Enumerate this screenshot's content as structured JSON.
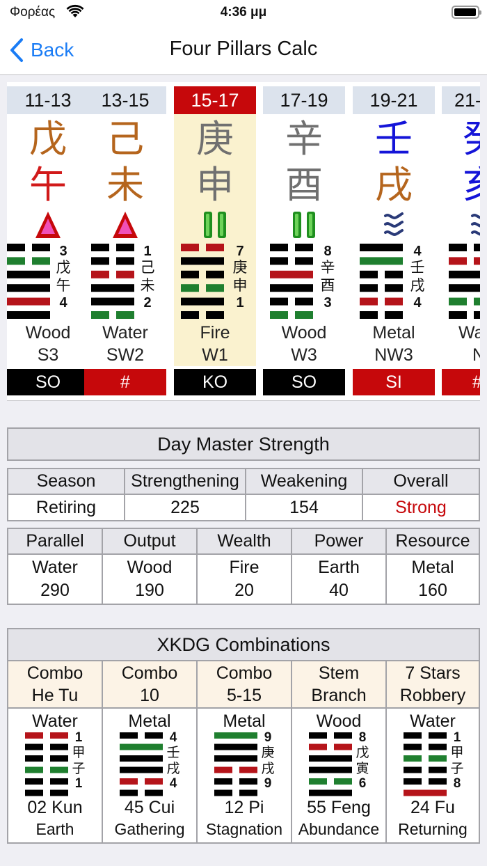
{
  "status": {
    "carrier": "Φορέας",
    "time": "4:36 μμ"
  },
  "nav": {
    "back": "Back",
    "title": "Four Pillars Calc"
  },
  "colors": {
    "accent": "#1a7cf5",
    "red": "#c6080b",
    "green": "#1f7f2f",
    "earth": "#b5651d",
    "metal": "#707070",
    "water": "#1414d8"
  },
  "pillars": [
    {
      "hour": "11-13",
      "stem": "戊",
      "stem_color": "#b5651d",
      "branch": "午",
      "branch_color": "#d11a1a",
      "symbol": "fire-triangle-icon",
      "hex_top": "3",
      "hex_chars": [
        "戊",
        "午"
      ],
      "hex_bottom": "4",
      "lines": [
        "yy",
        "gyy",
        "bb",
        "bb",
        "ry",
        "bb"
      ],
      "element": "Wood",
      "position": "S3",
      "tag": "SO",
      "tag_color": "black"
    },
    {
      "hour": "13-15",
      "stem": "己",
      "stem_color": "#b5651d",
      "branch": "未",
      "branch_color": "#b5651d",
      "symbol": "fire-triangle-icon",
      "hex_top": "1",
      "hex_chars": [
        "己",
        "未"
      ],
      "hex_bottom": "2",
      "lines": [
        "yy",
        "yy",
        "ryy",
        "bb",
        "bb",
        "gyy"
      ],
      "element": "Water",
      "position": "SW2",
      "tag": "#",
      "tag_color": "red"
    },
    {
      "hour": "15-17",
      "stem": "庚",
      "stem_color": "#707070",
      "branch": "申",
      "branch_color": "#707070",
      "symbol": "metal-bars-icon",
      "hex_top": "7",
      "hex_chars": [
        "庚",
        "申"
      ],
      "hex_bottom": "1",
      "lines": [
        "ryy",
        "bb",
        "yy",
        "gyy",
        "bb",
        "yy"
      ],
      "element": "Fire",
      "position": "W1",
      "tag": "KO",
      "tag_color": "black"
    },
    {
      "hour": "17-19",
      "stem": "辛",
      "stem_color": "#707070",
      "branch": "酉",
      "branch_color": "#707070",
      "symbol": "metal-bars-icon",
      "hex_top": "8",
      "hex_chars": [
        "辛",
        "酉"
      ],
      "hex_bottom": "3",
      "lines": [
        "yy",
        "yy",
        "rb",
        "bb",
        "yy",
        "gyy"
      ],
      "element": "Wood",
      "position": "W3",
      "tag": "SO",
      "tag_color": "black"
    },
    {
      "hour": "19-21",
      "stem": "壬",
      "stem_color": "#1414d8",
      "branch": "戌",
      "branch_color": "#b5651d",
      "symbol": "water-waves-icon",
      "hex_top": "4",
      "hex_chars": [
        "壬",
        "戌"
      ],
      "hex_bottom": "4",
      "lines": [
        "bb",
        "gb",
        "yy",
        "yy",
        "ryy",
        "yy"
      ],
      "element": "Metal",
      "position": "NW3",
      "tag": "SI",
      "tag_color": "red"
    },
    {
      "hour": "21-",
      "stem": "癸",
      "stem_color": "#1414d8",
      "branch": "亥",
      "branch_color": "#1414d8",
      "symbol": "water-waves-icon",
      "hex_top": "",
      "hex_chars": [
        "",
        ""
      ],
      "hex_bottom": "",
      "lines": [
        "yy",
        "ryy",
        "bb",
        "bb",
        "gyy",
        "yy"
      ],
      "element": "Wa",
      "position": "N",
      "tag": "#",
      "tag_color": "red"
    }
  ],
  "strength": {
    "title": "Day Master Strength",
    "headers": [
      "Season",
      "Strengthening",
      "Weakening",
      "Overall"
    ],
    "values": [
      "Retiring",
      "225",
      "154",
      "Strong"
    ],
    "overall_color": "#c6080b",
    "elements": [
      {
        "label": "Parallel",
        "element": "Water",
        "value": "290"
      },
      {
        "label": "Output",
        "element": "Wood",
        "value": "190"
      },
      {
        "label": "Wealth",
        "element": "Fire",
        "value": "20"
      },
      {
        "label": "Power",
        "element": "Earth",
        "value": "40"
      },
      {
        "label": "Resource",
        "element": "Metal",
        "value": "160"
      }
    ]
  },
  "xkdg": {
    "title": "XKDG Combinations",
    "combos": [
      {
        "h1": "Combo",
        "h2": "He Tu",
        "element": "Water",
        "top": "1",
        "chars": [
          "甲",
          "子"
        ],
        "bottom": "1",
        "lines": [
          "ryy",
          "yy",
          "yy",
          "gyy",
          "yy",
          "yy"
        ],
        "name": "02 Kun",
        "meaning": "Earth"
      },
      {
        "h1": "Combo",
        "h2": "10",
        "element": "Metal",
        "top": "4",
        "chars": [
          "壬",
          "戌"
        ],
        "bottom": "4",
        "lines": [
          "yy",
          "gb",
          "bb",
          "bb",
          "ryy",
          "yy"
        ],
        "name": "45 Cui",
        "meaning": "Gathering"
      },
      {
        "h1": "Combo",
        "h2": "5-15",
        "element": "Metal",
        "top": "9",
        "chars": [
          "庚",
          "戌"
        ],
        "bottom": "9",
        "lines": [
          "gb",
          "bb",
          "bb",
          "ryy",
          "yy",
          "yy"
        ],
        "name": "12 Pi",
        "meaning": "Stagnation"
      },
      {
        "h1": "Stem",
        "h2": "Branch",
        "element": "Wood",
        "top": "8",
        "chars": [
          "戊",
          "寅"
        ],
        "bottom": "6",
        "lines": [
          "yy",
          "ryy",
          "bb",
          "bb",
          "gyy",
          "bb"
        ],
        "name": "55 Feng",
        "meaning": "Abundance"
      },
      {
        "h1": "7 Stars",
        "h2": "Robbery",
        "element": "Water",
        "top": "1",
        "chars": [
          "甲",
          "子"
        ],
        "bottom": "8",
        "lines": [
          "yy",
          "yy",
          "gyy",
          "yy",
          "yy",
          "rb"
        ],
        "name": "24 Fu",
        "meaning": "Returning"
      }
    ]
  }
}
